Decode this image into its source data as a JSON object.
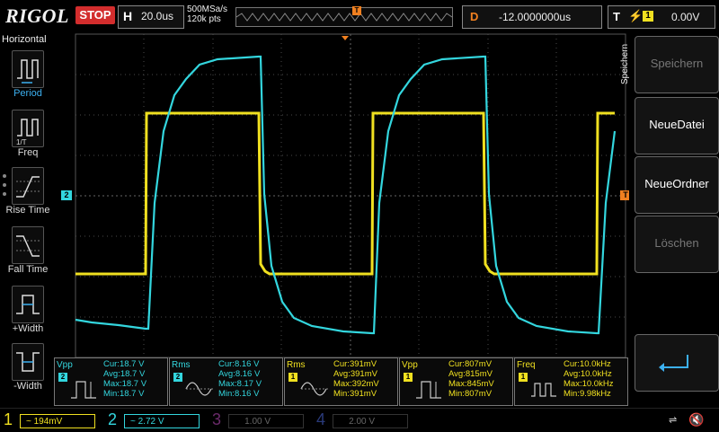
{
  "top": {
    "logo": "RIGOL",
    "run_state": "STOP",
    "horizontal_label": "H",
    "timebase": "20.0us",
    "sample_rate": "500MSa/s",
    "memory_depth": "120k pts",
    "delay_label": "D",
    "delay": "-12.0000000us",
    "trigger_label": "T",
    "trigger_source": "1",
    "trigger_level": "0.00V",
    "trigger_marker": "T"
  },
  "left_menu": {
    "title": "Horizontal",
    "items": [
      {
        "label": "Period",
        "icon": "period-icon"
      },
      {
        "label": "Freq",
        "icon": "frequency-icon"
      },
      {
        "label": "Rise Time",
        "icon": "rise-time-icon"
      },
      {
        "label": "Fall Time",
        "icon": "fall-time-icon"
      },
      {
        "label": "+Width",
        "icon": "positive-width-icon"
      },
      {
        "label": "-Width",
        "icon": "negative-width-icon"
      }
    ]
  },
  "right_menu": {
    "title": "Speichern",
    "buttons": [
      {
        "label": "Speichern",
        "state": "disabled"
      },
      {
        "label": "NeueDatei",
        "state": "enabled"
      },
      {
        "label": "NeueOrdner",
        "state": "enabled"
      },
      {
        "label": "Löschen",
        "state": "disabled"
      },
      {
        "label": "",
        "icon": "enter-icon",
        "state": "enabled"
      }
    ]
  },
  "markers": {
    "ch2_ground": "2",
    "trigger_level_marker": "T"
  },
  "measurements": [
    {
      "name": "Vpp",
      "channel": "2",
      "color": "#33d6de",
      "cur": "18.7 V",
      "avg": "18.7 V",
      "max": "18.7 V",
      "min": "18.7 V"
    },
    {
      "name": "Rms",
      "channel": "2",
      "color": "#33d6de",
      "cur": "8.16 V",
      "avg": "8.16 V",
      "max": "8.17 V",
      "min": "8.16 V"
    },
    {
      "name": "Rms",
      "channel": "1",
      "color": "#f0e020",
      "cur": "391mV",
      "avg": "391mV",
      "max": "392mV",
      "min": "391mV"
    },
    {
      "name": "Vpp",
      "channel": "1",
      "color": "#f0e020",
      "cur": "807mV",
      "avg": "815mV",
      "max": "845mV",
      "min": "807mV"
    },
    {
      "name": "Freq",
      "channel": "1",
      "color": "#f0e020",
      "cur": "10.0kHz",
      "avg": "10.0kHz",
      "max": "10.0kHz",
      "min": "9.98kHz"
    }
  ],
  "meas_labels": {
    "cur": "Cur:",
    "avg": "Avg:",
    "max": "Max:",
    "min": "Min:"
  },
  "channels": [
    {
      "num": "1",
      "scale": "194mV",
      "color": "#f0e020",
      "active": true
    },
    {
      "num": "2",
      "scale": "2.72 V",
      "color": "#33d6de",
      "active": true
    },
    {
      "num": "3",
      "scale": "1.00 V",
      "color": "#c030c0",
      "active": false
    },
    {
      "num": "4",
      "scale": "2.00 V",
      "color": "#3060f0",
      "active": false
    }
  ],
  "colors": {
    "ch1": "#f0e020",
    "ch2": "#33d6de",
    "trigger": "#f08020",
    "stop": "#d32d2d"
  }
}
